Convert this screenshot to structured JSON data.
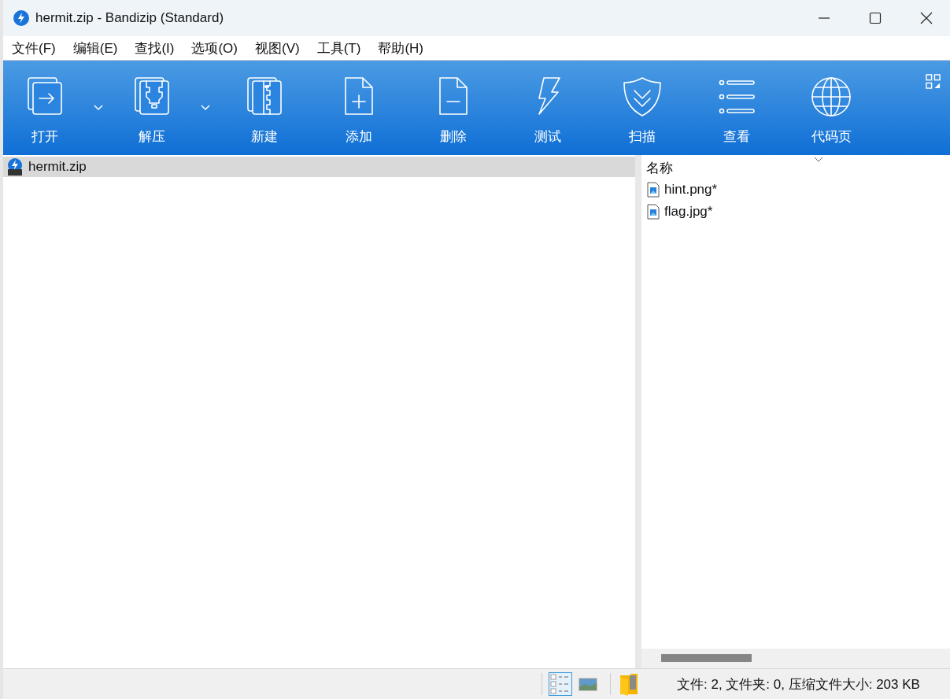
{
  "window": {
    "title": "hermit.zip - Bandizip (Standard)"
  },
  "menu": [
    "文件(F)",
    "编辑(E)",
    "查找(I)",
    "选项(O)",
    "视图(V)",
    "工具(T)",
    "帮助(H)"
  ],
  "toolbar": [
    {
      "label": "打开",
      "has_dropdown": true
    },
    {
      "label": "解压",
      "has_dropdown": true
    },
    {
      "label": "新建",
      "has_dropdown": false
    },
    {
      "label": "添加",
      "has_dropdown": false
    },
    {
      "label": "删除",
      "has_dropdown": false
    },
    {
      "label": "测试",
      "has_dropdown": false
    },
    {
      "label": "扫描",
      "has_dropdown": false
    },
    {
      "label": "查看",
      "has_dropdown": false
    },
    {
      "label": "代码页",
      "has_dropdown": false
    }
  ],
  "tree": [
    {
      "label": "hermit.zip",
      "selected": true
    }
  ],
  "file_list": {
    "columns": [
      "名称"
    ],
    "rows": [
      {
        "name": "hint.png*",
        "selected": false
      },
      {
        "name": "flag.jpg*",
        "selected": false
      }
    ]
  },
  "status_bar": {
    "views": [
      {
        "selected": true
      },
      {
        "selected": false
      }
    ],
    "text": "文件: 2, 文件夹: 0, 压缩文件大小: 203 KB"
  }
}
